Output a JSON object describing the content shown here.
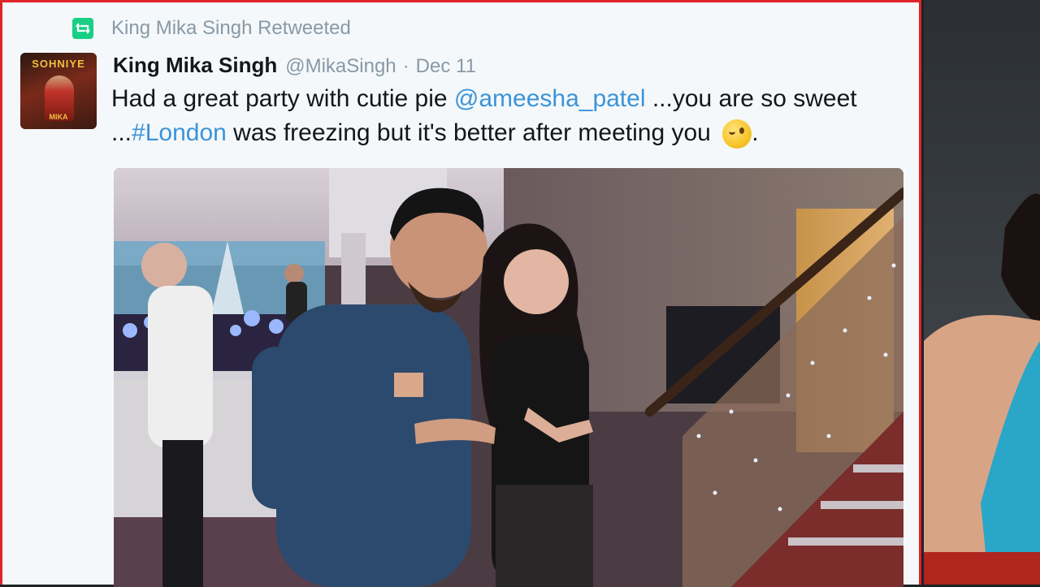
{
  "retweet": {
    "label": "King Mika Singh Retweeted",
    "icon": "retweet-icon",
    "color": "#19cf86"
  },
  "tweet": {
    "author_name": "King Mika Singh",
    "handle": "@MikaSingh",
    "separator": "·",
    "date": "Dec 11",
    "text_parts": {
      "p1": "Had a great party with cutie pie ",
      "mention": "@ameesha_patel",
      "p2": " ...you are so sweet ...",
      "hashtag": "#London",
      "p3": " was freezing but it's better after meeting you ",
      "p4": "."
    },
    "emoji": "winking-face",
    "link_color": "#3b94d9"
  },
  "avatar": {
    "label": "SOHNIYE",
    "sub_label": "MIKA"
  },
  "colors": {
    "card_background": "#f5f8fa",
    "border": "#e0242a",
    "muted_text": "#8899a6",
    "body_text": "#14171a"
  }
}
